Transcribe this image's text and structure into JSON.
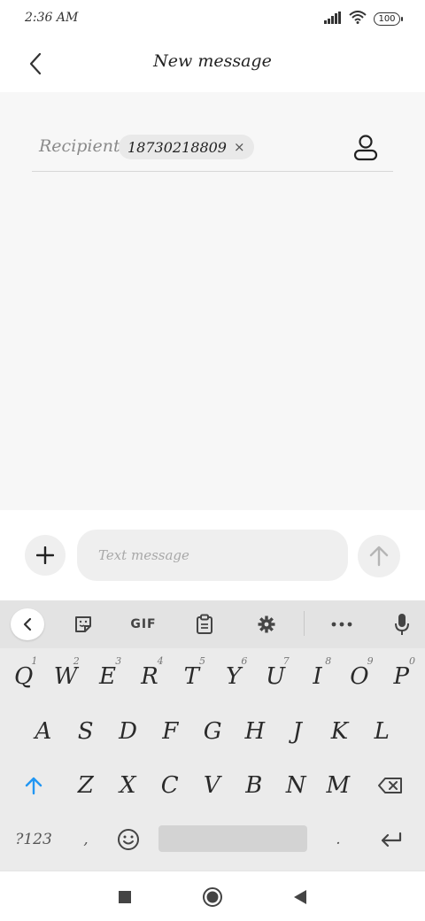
{
  "status_bar": {
    "time": "2:36 AM",
    "battery": "100"
  },
  "title_bar": {
    "title": "New message"
  },
  "recipient": {
    "label": "Recipient:",
    "chip_number": "18730218809",
    "chip_remove": "×"
  },
  "composer": {
    "placeholder": "Text message"
  },
  "keyboard": {
    "toolbar": {
      "gif_label": "GIF"
    },
    "row1": [
      {
        "label": "Q",
        "hint": "1"
      },
      {
        "label": "W",
        "hint": "2"
      },
      {
        "label": "E",
        "hint": "3"
      },
      {
        "label": "R",
        "hint": "4"
      },
      {
        "label": "T",
        "hint": "5"
      },
      {
        "label": "Y",
        "hint": "6"
      },
      {
        "label": "U",
        "hint": "7"
      },
      {
        "label": "I",
        "hint": "8"
      },
      {
        "label": "O",
        "hint": "9"
      },
      {
        "label": "P",
        "hint": "0"
      }
    ],
    "row2": [
      "A",
      "S",
      "D",
      "F",
      "G",
      "H",
      "J",
      "K",
      "L"
    ],
    "row3": [
      "Z",
      "X",
      "C",
      "V",
      "B",
      "N",
      "M"
    ],
    "row4": {
      "symbols": "?123",
      "comma": ",",
      "period": "."
    }
  },
  "colors": {
    "accent_blue": "#2196f3",
    "background_grey": "#f7f7f7",
    "keyboard_grey": "#ebebeb"
  }
}
